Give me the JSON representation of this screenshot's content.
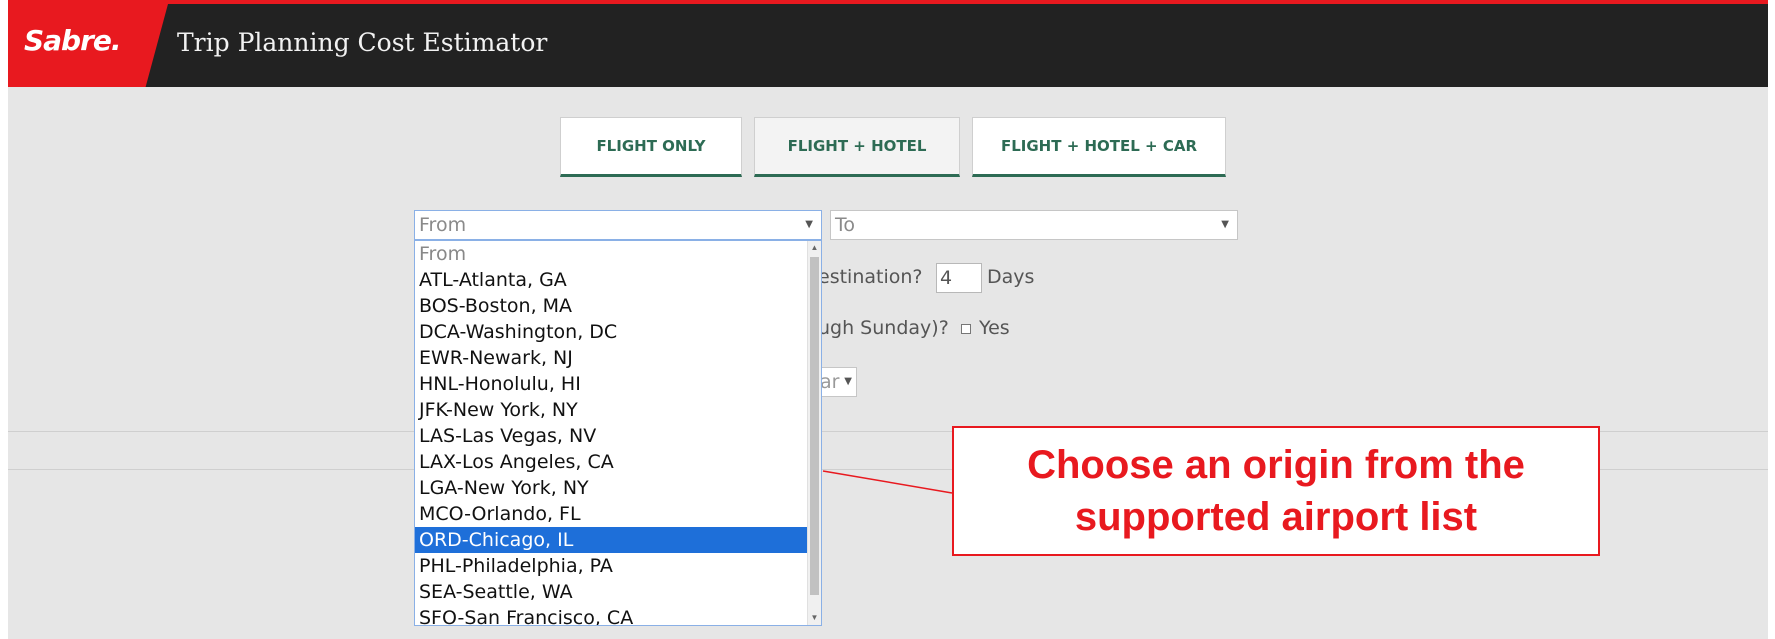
{
  "header": {
    "brand": "Sabre.",
    "title": "Trip Planning Cost Estimator"
  },
  "modes": [
    {
      "label": "FLIGHT ONLY",
      "active": false
    },
    {
      "label": "FLIGHT + HOTEL",
      "active": true
    },
    {
      "label": "FLIGHT + HOTEL + CAR",
      "active": false
    }
  ],
  "from_select": {
    "value": "From"
  },
  "to_select": {
    "value": "To"
  },
  "stay": {
    "question_fragment": "estination?",
    "days_value": "4",
    "days_label": "Days"
  },
  "weekend": {
    "question_fragment": "ugh Sunday)?",
    "yes_label": "Yes"
  },
  "partial_select": {
    "value": "ar"
  },
  "dropdown": {
    "options": [
      {
        "label": "From"
      },
      {
        "label": "ATL-Atlanta, GA"
      },
      {
        "label": "BOS-Boston, MA"
      },
      {
        "label": "DCA-Washington, DC"
      },
      {
        "label": "EWR-Newark, NJ"
      },
      {
        "label": "HNL-Honolulu, HI"
      },
      {
        "label": "JFK-New York, NY"
      },
      {
        "label": "LAS-Las Vegas, NV"
      },
      {
        "label": "LAX-Los Angeles, CA"
      },
      {
        "label": "LGA-New York, NY"
      },
      {
        "label": "MCO-Orlando, FL"
      },
      {
        "label": "ORD-Chicago, IL"
      },
      {
        "label": "PHL-Philadelphia, PA"
      },
      {
        "label": "SEA-Seattle, WA"
      },
      {
        "label": "SFO-San Francisco, CA"
      }
    ],
    "selected_label": "ORD-Chicago, IL"
  },
  "callout": {
    "line1": "Choose an origin from the",
    "line2": "supported airport list"
  },
  "colors": {
    "brand_red": "#e8191f",
    "header_bg": "#222222",
    "accent_green": "#2d6b54",
    "selection_blue": "#1e6fd9"
  }
}
